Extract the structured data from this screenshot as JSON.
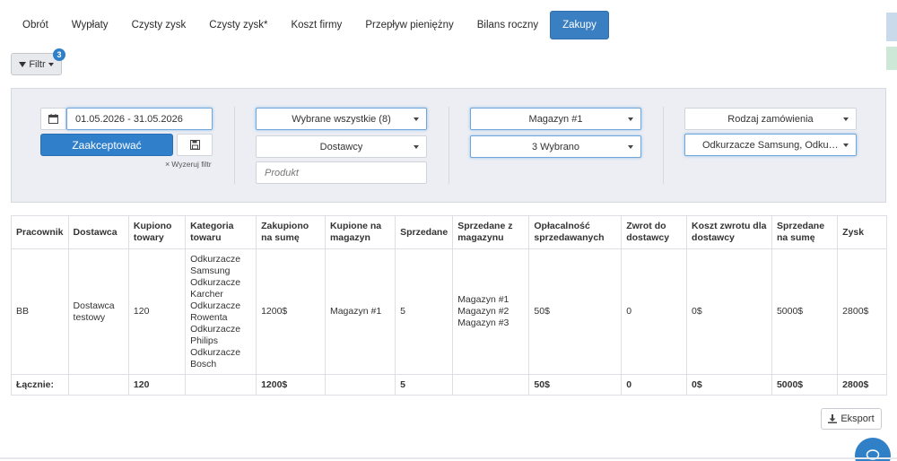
{
  "tabs": [
    {
      "label": "Obrót",
      "active": false
    },
    {
      "label": "Wypłaty",
      "active": false
    },
    {
      "label": "Czysty zysk",
      "active": false
    },
    {
      "label": "Czysty zysk*",
      "active": false
    },
    {
      "label": "Koszt firmy",
      "active": false
    },
    {
      "label": "Przepływ pieniężny",
      "active": false
    },
    {
      "label": "Bilans roczny",
      "active": false
    },
    {
      "label": "Zakupy",
      "active": true
    }
  ],
  "filter_button": {
    "label": "Filtr",
    "badge_count": "3"
  },
  "filters": {
    "date_range": "01.05.2026 - 31.05.2026",
    "accept_label": "Zaakceptować",
    "clear_label": "Wyzeruj filtr",
    "selection_all": "Wybrane wszystkie (8)",
    "suppliers": "Dostawcy",
    "product_placeholder": "Produkt",
    "warehouse": "Magazyn #1",
    "selected_count": "3 Wybrano",
    "order_type": "Rodzaj zamówienia",
    "categories": "Odkurzacze Samsung, Odkurzacze Karcher"
  },
  "table": {
    "headers": [
      "Pracownik",
      "Dostawca",
      "Kupiono towary",
      "Kategoria towaru",
      "Zakupiono na sumę",
      "Kupione na magazyn",
      "Sprzedane",
      "Sprzedane z magazynu",
      "Opłacalność sprzedawanych",
      "Zwrot do dostawcy",
      "Koszt zwrotu dla dostawcy",
      "Sprzedane na sumę",
      "Zysk"
    ],
    "row": [
      "BB",
      "Dostawca testowy",
      "120",
      "Odkurzacze Samsung\nOdkurzacze Karcher\nOdkurzacze Rowenta\nOdkurzacze Philips\nOdkurzacze Bosch",
      "1200$",
      "Magazyn #1",
      "5",
      "Magazyn #1\nMagazyn #2\nMagazyn #3",
      "50$",
      "0",
      "0$",
      "5000$",
      "2800$"
    ],
    "totals": [
      "Łącznie:",
      "",
      "120",
      "",
      "1200$",
      "",
      "5",
      "",
      "50$",
      "0",
      "0$",
      "5000$",
      "2800$"
    ]
  },
  "export_label": "Eksport",
  "colors": {
    "accent": "#3a7fc2",
    "panel_bg": "#eceef4",
    "badge": "#2f80c7"
  },
  "icons": [
    "funnel-icon",
    "calendar-icon",
    "save-icon",
    "close-icon",
    "download-icon",
    "chat-icon"
  ]
}
